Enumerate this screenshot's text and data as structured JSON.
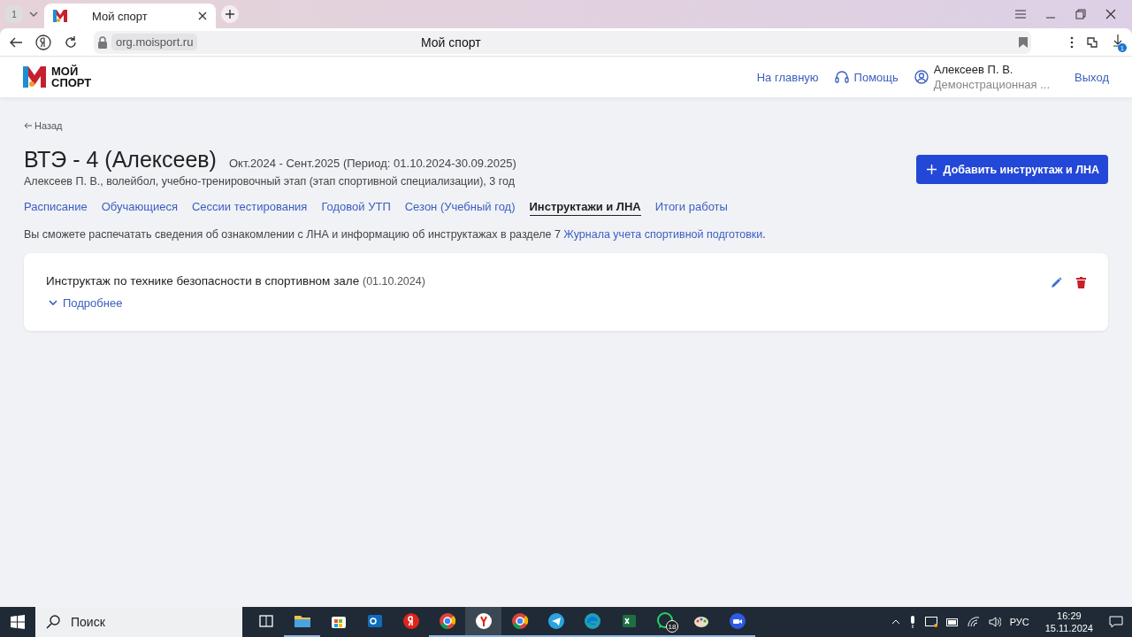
{
  "browser": {
    "tab_count": "1",
    "tab_title": "Мой спорт",
    "url": "org.moisport.ru",
    "page_title": "Мой спорт",
    "downloads_badge": "1"
  },
  "header": {
    "logo_lines": [
      "МОЙ",
      "СПОРТ"
    ],
    "home_link": "На главную",
    "help_link": "Помощь",
    "user_name": "Алексеев П. В.",
    "user_org": "Демонстрационная ...",
    "logout": "Выход"
  },
  "page": {
    "back": "Назад",
    "title": "ВТЭ - 4 (Алексеев)",
    "period": "Окт.2024 - Сент.2025 (Период: 01.10.2024-30.09.2025)",
    "subtitle": "Алексеев П. В., волейбол, учебно-тренировочный этап (этап спортивной специализации), 3 год",
    "add_button": "Добавить инструктаж и ЛНА",
    "tabs": [
      {
        "label": "Расписание",
        "selected": false
      },
      {
        "label": "Обучающиеся",
        "selected": false
      },
      {
        "label": "Сессии тестирования",
        "selected": false
      },
      {
        "label": "Годовой УТП",
        "selected": false
      },
      {
        "label": "Сезон (Учебный год)",
        "selected": false
      },
      {
        "label": "Инструктажи и ЛНА",
        "selected": true
      },
      {
        "label": "Итоги работы",
        "selected": false
      }
    ],
    "info": {
      "text": "Вы сможете распечатать сведения об ознакомлении с ЛНА и информацию об инструктажах в разделе 7 ",
      "link": "Журнала учета спортивной подготовки",
      "end": "."
    },
    "briefings": [
      {
        "title": "Инструктаж по технике безопасности в спортивном зале",
        "date": "(01.10.2024)",
        "details": "Подробнее",
        "expanded": false
      }
    ]
  },
  "taskbar": {
    "search_placeholder": "Поиск",
    "apps": [
      {
        "kind": "taskview",
        "running": false,
        "active": false
      },
      {
        "kind": "folder",
        "running": true,
        "active": false
      },
      {
        "kind": "store",
        "running": false,
        "active": false
      },
      {
        "kind": "outlook",
        "running": false,
        "active": false
      },
      {
        "kind": "yandex",
        "running": false,
        "active": false
      },
      {
        "kind": "chrome",
        "running": true,
        "active": false
      },
      {
        "kind": "ybrowser",
        "running": true,
        "active": true
      },
      {
        "kind": "chrome",
        "running": true,
        "active": false
      },
      {
        "kind": "telegram",
        "running": true,
        "active": false
      },
      {
        "kind": "edge",
        "running": true,
        "active": false
      },
      {
        "kind": "excel",
        "running": true,
        "active": false
      },
      {
        "kind": "whatsapp",
        "running": true,
        "active": false,
        "badge": "18"
      },
      {
        "kind": "paint",
        "running": true,
        "active": false
      },
      {
        "kind": "zoom",
        "running": true,
        "active": false
      }
    ],
    "language": "РУС",
    "time": "16:29",
    "date": "15.11.2024"
  }
}
